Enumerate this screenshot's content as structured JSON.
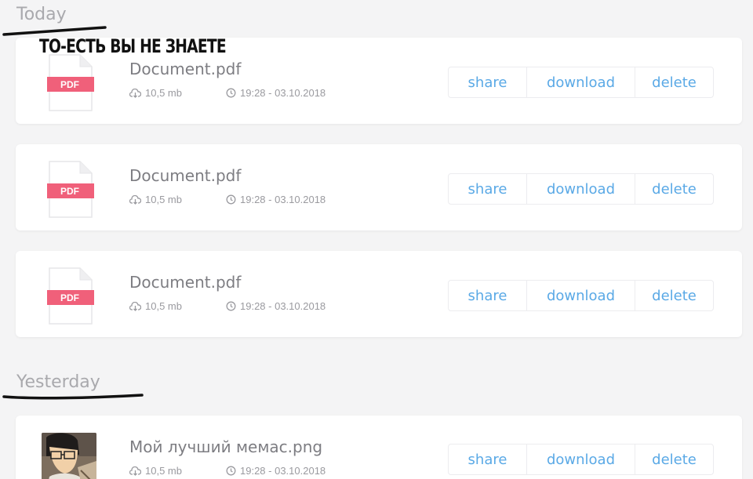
{
  "sections": {
    "today": "Today",
    "yesterday": "Yesterday"
  },
  "caption": "ТО-ЕСТЬ ВЫ НЕ ЗНАЕТЕ",
  "files": [
    {
      "name": "Document.pdf",
      "type_label": "PDF",
      "size": "10,5 mb",
      "time": "19:28 - 03.10.2018"
    },
    {
      "name": "Document.pdf",
      "type_label": "PDF",
      "size": "10,5 mb",
      "time": "19:28 - 03.10.2018"
    },
    {
      "name": "Document.pdf",
      "type_label": "PDF",
      "size": "10,5 mb",
      "time": "19:28 - 03.10.2018"
    },
    {
      "name": "Мой лучший мемас.png",
      "size": "10,5 mb",
      "time": "19:28 - 03.10.2018"
    }
  ],
  "actions": {
    "share": "share",
    "download": "download",
    "delete": "delete"
  },
  "colors": {
    "accent": "#5aa9e6",
    "pdf_badge": "#f0607a",
    "background": "#f4f4f5"
  },
  "icons": {
    "size": "cloud-download-icon",
    "time": "clock-icon",
    "file": "pdf-file-icon"
  }
}
